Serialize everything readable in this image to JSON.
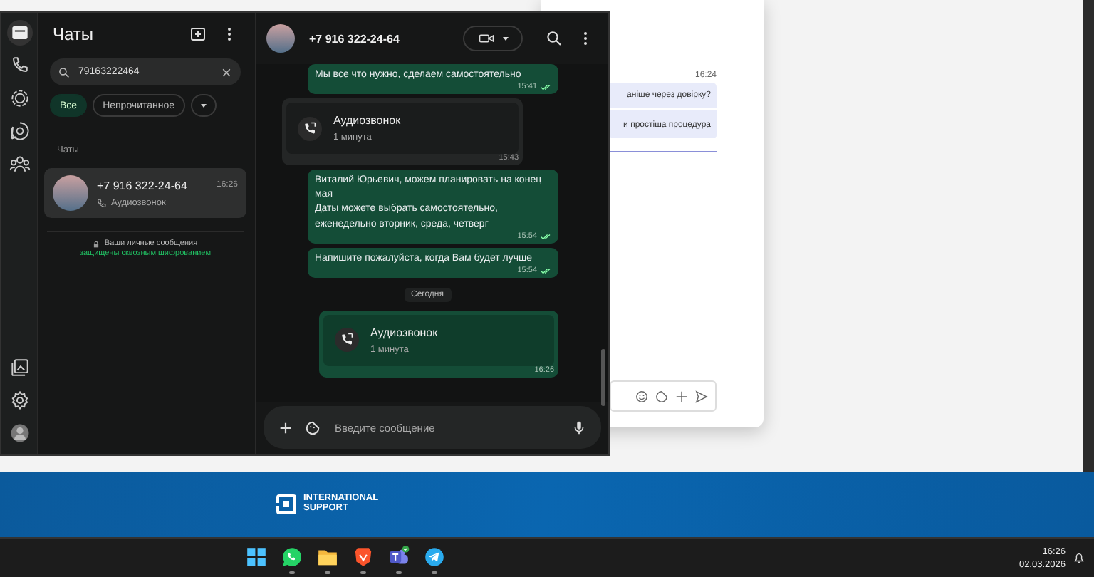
{
  "rail": {
    "top": [
      {
        "kind": "chats",
        "selected": true
      },
      {
        "kind": "calls",
        "selected": false
      },
      {
        "kind": "status",
        "selected": false
      },
      {
        "kind": "channels",
        "selected": false
      },
      {
        "kind": "communities",
        "selected": false
      }
    ],
    "bottom": [
      {
        "kind": "media",
        "selected": false
      },
      {
        "kind": "settings",
        "selected": false
      },
      {
        "kind": "profile",
        "selected": false
      }
    ]
  },
  "chat_list": {
    "title": "Чаты",
    "search": {
      "value": "79163222464"
    },
    "filters": [
      {
        "label": "Все",
        "selected": true
      },
      {
        "label": "Непрочитанное",
        "selected": false
      },
      {
        "kind": "more",
        "selected": false
      }
    ],
    "section": "Чаты",
    "chats": [
      {
        "name": "+7 916 322-24-64",
        "time": "16:26",
        "preview": "Аудиозвонок",
        "selected": true
      }
    ],
    "note": "Ваши личные сообщения",
    "note_link": "защищены сквозным шифрованием"
  },
  "conversation": {
    "title": "+7 916 322-24-64",
    "messages": [
      {
        "kind": "text",
        "outgoing": true,
        "text": "Мы все что нужно, сделаем самостоятельно",
        "time": "15:41",
        "read": true
      },
      {
        "kind": "call",
        "outgoing": false,
        "title": "Аудиозвонок",
        "detail": "1 минута",
        "time": "15:43"
      },
      {
        "kind": "text",
        "outgoing": true,
        "text": "Виталий Юрьевич, можем планировать на конец мая\nДаты можете выбрать самостоятельно, еженедельно вторник, среда, четверг",
        "time": "15:54",
        "read": true
      },
      {
        "kind": "text",
        "outgoing": true,
        "text": "Напишите пожалуйста, когда Вам будет лучше",
        "time": "15:54",
        "read": true
      },
      {
        "kind": "date",
        "text": "Сегодня"
      },
      {
        "kind": "call",
        "outgoing": true,
        "title": "Аудиозвонок",
        "detail": "1 минута",
        "time": "16:26"
      }
    ],
    "compose": {
      "placeholder": "Введите сообщение"
    }
  },
  "back_window": {
    "time": "16:24",
    "lines": [
      "аніше через довірку?",
      "и простіша процедура"
    ]
  },
  "banner": {
    "logo_line1": "INTERNATIONAL",
    "logo_line2": "SUPPORT"
  },
  "taskbar": {
    "apps": [
      {
        "kind": "start",
        "running": false
      },
      {
        "kind": "whatsapp",
        "running": true
      },
      {
        "kind": "folder",
        "running": true
      },
      {
        "kind": "browser",
        "running": true
      },
      {
        "kind": "teams",
        "running": true
      },
      {
        "kind": "telegram",
        "running": true
      }
    ],
    "time": "16:26",
    "date": "02.03.2026"
  }
}
